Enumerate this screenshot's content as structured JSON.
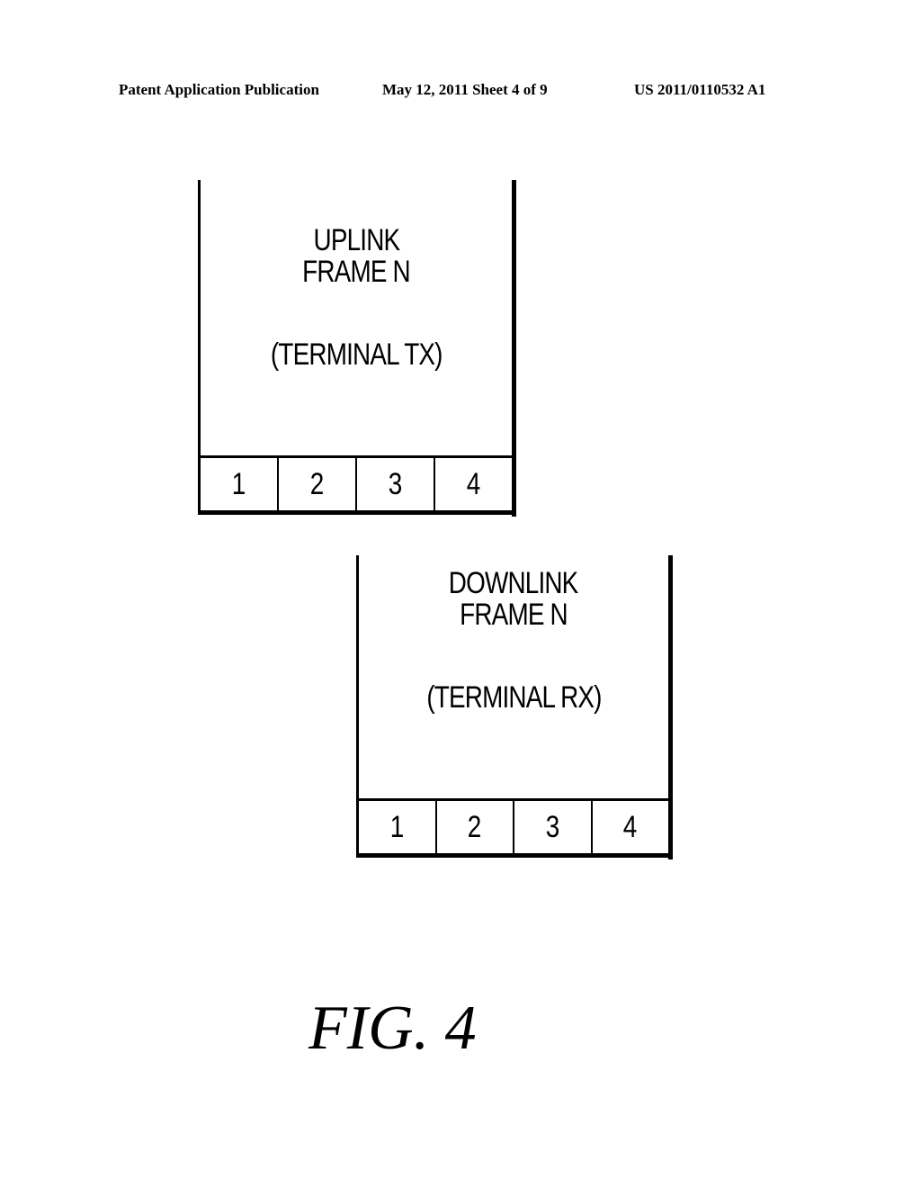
{
  "header": {
    "left": "Patent Application Publication",
    "middle": "May 12, 2011  Sheet 4 of 9",
    "right": "US 2011/0110532 A1"
  },
  "frames": [
    {
      "title_line1": "UPLINK",
      "title_line2": "FRAME N",
      "subtitle": "(TERMINAL TX)",
      "slots": [
        "1",
        "2",
        "3",
        "4"
      ]
    },
    {
      "title_line1": "DOWNLINK",
      "title_line2": "FRAME N",
      "subtitle": "(TERMINAL RX)",
      "slots": [
        "1",
        "2",
        "3",
        "4"
      ]
    }
  ],
  "caption": "FIG. 4"
}
